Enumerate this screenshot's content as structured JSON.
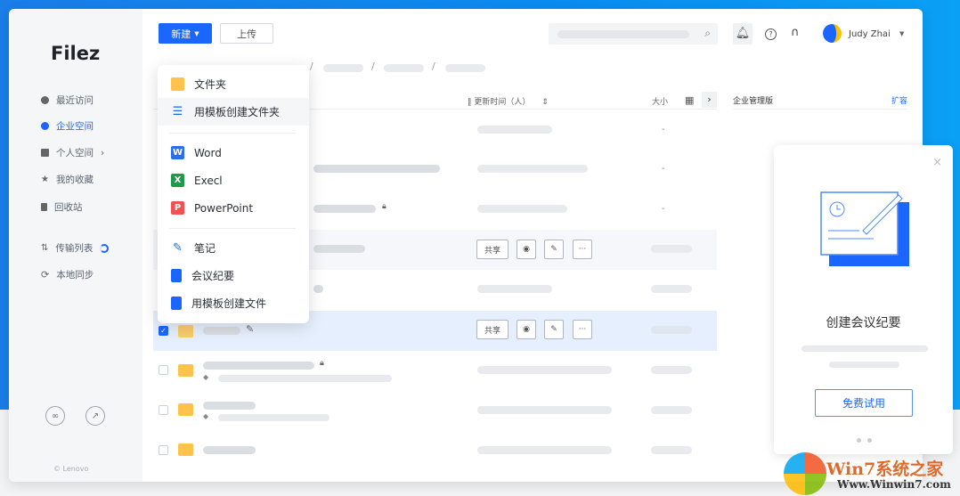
{
  "app": {
    "logo": "Filez",
    "copyright": "© Lenovo"
  },
  "sidebar": {
    "items": [
      {
        "label": "最近访问",
        "icon": "clock-icon"
      },
      {
        "label": "企业空间",
        "icon": "enterprise-icon",
        "active": true
      },
      {
        "label": "个人空间",
        "icon": "book-icon"
      },
      {
        "label": "我的收藏",
        "icon": "star-icon"
      },
      {
        "label": "回收站",
        "icon": "trash-icon"
      },
      {
        "label": "传输列表",
        "icon": "transfer-icon"
      },
      {
        "label": "本地同步",
        "icon": "sync-icon"
      }
    ]
  },
  "toolbar": {
    "new_label": "新建",
    "upload_label": "上传"
  },
  "header": {
    "user": "Judy Zhai"
  },
  "table": {
    "col_time": "更新时间（人）",
    "col_size": "大小",
    "size_dash": "-"
  },
  "row_actions": {
    "share": "共享",
    "more": "···"
  },
  "right_panel": {
    "title": "企业管理版",
    "expand": "扩容"
  },
  "menu": {
    "items": [
      "文件夹",
      "用模板创建文件夹",
      "Word",
      "Execl",
      "PowerPoint",
      "笔记",
      "会议纪要",
      "用模板创建文件"
    ]
  },
  "promo": {
    "title": "创建会议纪要",
    "button": "免费试用"
  },
  "colors": {
    "accent": "#1a66ff",
    "word": "#2b6fe8",
    "excel": "#1e9a4c",
    "ppt": "#f05252",
    "folder": "#ffc24a"
  },
  "watermark": {
    "text": "Win7系统之家",
    "url_text": "Www.Winwin7.com"
  }
}
